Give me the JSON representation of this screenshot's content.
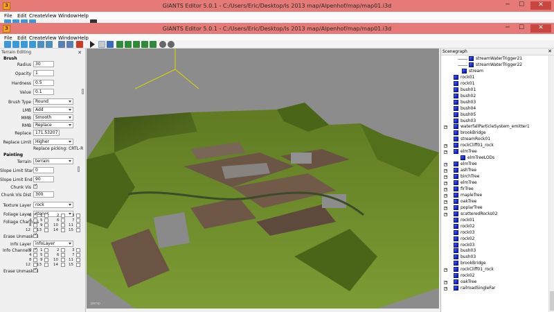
{
  "back_window": {
    "title": "GIANTS Editor 5.0.1 - C:/Users/Eric/Desktop/ls 2013 map/Alpenhof/map/map01.i3d",
    "menus": [
      "File",
      "Edit",
      "Create",
      "View",
      "Window",
      "Help"
    ]
  },
  "window": {
    "title": "GIANTS Editor 5.0.1 - C:/Users/Eric/Desktop/ls 2013 map/Alpenhof/map/map01.i3d",
    "menus": [
      "File",
      "Edit",
      "Create",
      "View",
      "Window",
      "Help"
    ],
    "app_icon_text": "3",
    "min_glyph": "─",
    "max_glyph": "☐",
    "close_glyph": "✕"
  },
  "terrain_panel": {
    "header": "Terrain Editing",
    "brush": {
      "section": "Brush",
      "radius_label": "Radius",
      "radius": "30",
      "opacity_label": "Opacity",
      "opacity": "1",
      "hardness_label": "Hardness",
      "hardness": "0.5",
      "value_label": "Value",
      "value": "0.1",
      "brush_type_label": "Brush Type",
      "brush_type": "Round",
      "lmb_label": "LMB",
      "lmb": "Add",
      "mmb_label": "MMB",
      "mmb": "Smooth",
      "rmb_label": "RMB",
      "rmb": "Replace",
      "replace_label": "Replace",
      "replace": "171.53207",
      "replace_limit_label": "Replace Limit",
      "replace_limit": "Higher",
      "replace_picking": "Replace picking: CRTL-R"
    },
    "painting": {
      "section": "Painting",
      "terrain_label": "Terrain",
      "terrain": "terrain",
      "slope_start_label": "Slope Limit Start",
      "slope_start": "0",
      "slope_end_label": "Slope Limit End",
      "slope_end": "90",
      "chunk_vis_label": "Chunk Vis",
      "chunk_vis_dist_label": "Chunk Vis Dist",
      "chunk_vis_dist": "300",
      "texture_layer_label": "Texture Layer",
      "texture_layer": "rock",
      "foliage_layer_label": "Foliage Layer",
      "foliage_layer": "stones",
      "foliage_channels_label": "Foliage Channels",
      "erase_unmasked_label": "Erase Unmasked",
      "info_layer_label": "Info Layer",
      "info_layer": "infoLayer",
      "info_channels_label": "Info Channels",
      "erase_unmasked2_label": "Erase Unmasked"
    },
    "channel_numbers": [
      "0",
      "1",
      "2",
      "3",
      "4",
      "5",
      "6",
      "7",
      "8",
      "9",
      "10",
      "11",
      "12",
      "13",
      "14",
      "15"
    ]
  },
  "viewport": {
    "label": "persp"
  },
  "scenegraph": {
    "header": "Scenegraph",
    "items": [
      "streamWaterTrigger21",
      "streamWaterTrigger22",
      "stream",
      "rock01",
      "rock01",
      "bush01",
      "bush02",
      "bush03",
      "bush04",
      "bush05",
      "bush03",
      "waterfallParticleSystem_emitter1",
      "brookBridge",
      "streamRock01",
      "rockCliff01_rock",
      "elmTree",
      "elmTreeLODs",
      "elmTree",
      "ashTree",
      "birchTree",
      "elmTree",
      "firTree",
      "mapleTree",
      "oakTree",
      "poplarTree",
      "scatteredRocks02",
      "rock01",
      "rock02",
      "rock03",
      "rock02",
      "rock03",
      "bush03",
      "bush03",
      "brookBridge",
      "rockCliff01_rock",
      "rock02",
      "oakTree",
      "railroadSingleFar"
    ]
  },
  "colors": {
    "titlebar": "#e57a76",
    "close_button": "#c94640",
    "grass": "#6b8a2a",
    "node_icon": "#1a2bd6"
  }
}
